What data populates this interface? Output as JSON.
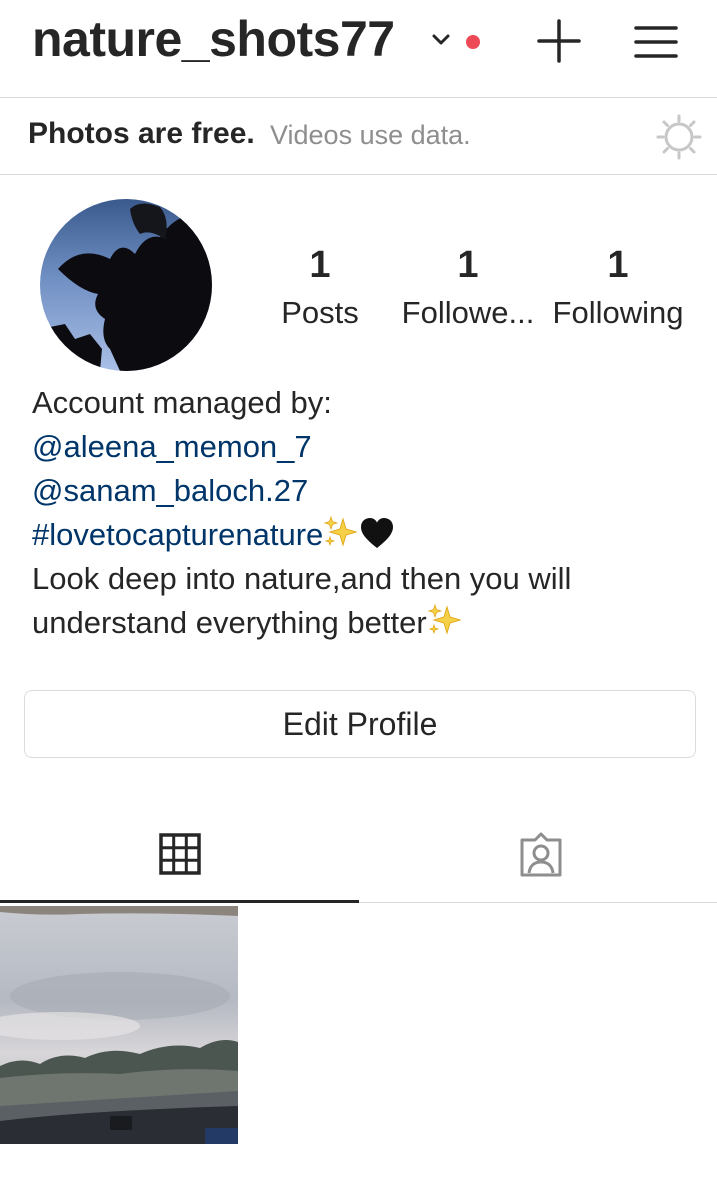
{
  "header": {
    "username": "nature_shots77",
    "switch_account_icon": "chevron-down-icon",
    "notification_dot_color": "#ed4956",
    "new_post_icon": "plus-icon",
    "menu_icon": "hamburger-menu-icon"
  },
  "data_saver_banner": {
    "bold_text": "Photos are free.",
    "light_text": "Videos use data.",
    "icon": "sun-icon"
  },
  "profile": {
    "stats": [
      {
        "value": "1",
        "label": "Posts"
      },
      {
        "value": "1",
        "label": "Followe..."
      },
      {
        "value": "1",
        "label": "Following"
      }
    ],
    "bio": {
      "line1": "Account managed by:",
      "mention1": "@aleena_memon_7",
      "mention2": "@sanam_baloch.27",
      "hashtag": "#lovetocapturenature",
      "line5": "Look deep into nature,and then you will",
      "line6": "understand everything better"
    },
    "link_color": "#003569"
  },
  "edit_profile_button": {
    "label": "Edit Profile"
  },
  "tabs": [
    {
      "icon": "grid-icon",
      "active": true
    },
    {
      "icon": "tagged-person-icon",
      "active": false
    }
  ],
  "posts": [
    {
      "thumbnail": "landscape-photo"
    }
  ]
}
